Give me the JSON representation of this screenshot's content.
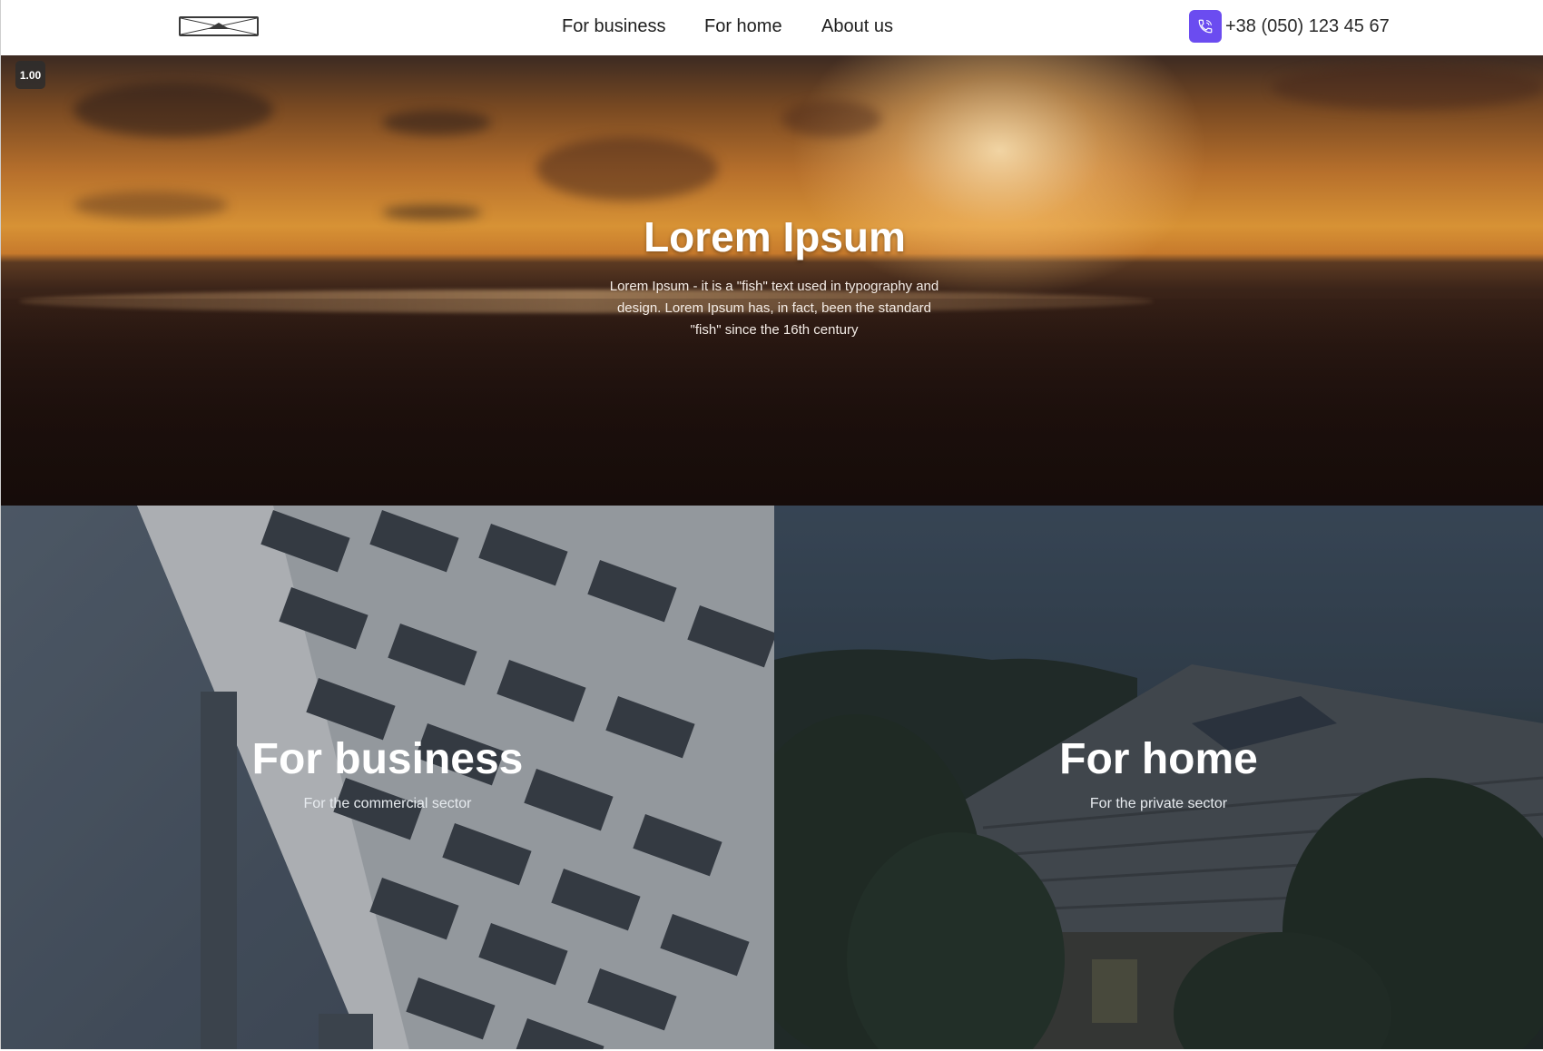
{
  "header": {
    "logo_icon": "image-placeholder-icon",
    "nav": [
      {
        "label": "For business"
      },
      {
        "label": "For home"
      },
      {
        "label": "About us"
      }
    ],
    "phone": {
      "icon": "phone-icon",
      "number": "+38 (050) 123 45 67",
      "accent_color": "#6b4cf0"
    }
  },
  "hero": {
    "title": "Lorem Ipsum",
    "description": "Lorem Ipsum - it is a \"fish\" text used in typography and design. Lorem Ipsum has, in fact, been the standard \"fish\" since the 16th century",
    "zoom_badge": "1.00"
  },
  "sectors": [
    {
      "title": "For business",
      "subtitle": "For the commercial sector"
    },
    {
      "title": "For home",
      "subtitle": "For the private sector"
    }
  ]
}
